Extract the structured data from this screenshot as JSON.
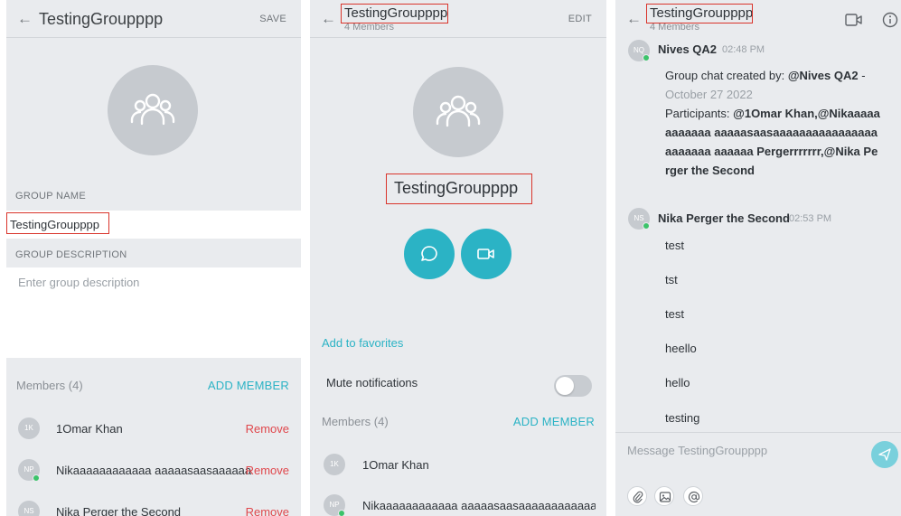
{
  "panel1": {
    "header_title": "TestingGroupppp",
    "header_action": "SAVE",
    "group_name_label": "GROUP NAME",
    "group_name_value": "TestingGroupppp",
    "group_description_label": "GROUP DESCRIPTION",
    "group_description_placeholder": "Enter group description",
    "members_label": "Members (4)",
    "add_member": "ADD MEMBER",
    "members": [
      {
        "initials": "1K",
        "name": "1Omar Khan",
        "action": "Remove"
      },
      {
        "initials": "NP",
        "name": "Nikaaaaaaaaaaaa aaaaasaasaaaaaaa...",
        "action": "Remove"
      },
      {
        "initials": "NS",
        "name": "Nika Perger the Second",
        "action": "Remove"
      }
    ]
  },
  "panel2": {
    "header_title": "TestingGroupppp",
    "header_subtitle": "4 Members",
    "header_action": "EDIT",
    "group_name": "TestingGroupppp",
    "add_to_favorites": "Add to favorites",
    "mute_notifications": "Mute notifications",
    "members_label": "Members (4)",
    "add_member": "ADD MEMBER",
    "members": [
      {
        "initials": "1K",
        "name": "1Omar Khan"
      },
      {
        "initials": "NP",
        "name": "Nikaaaaaaaaaaaa aaaaasaasaaaaaaaaaaaaaaa..."
      }
    ]
  },
  "panel3": {
    "header_title": "TestingGroupppp",
    "header_subtitle": "4 Members",
    "messages": [
      {
        "initials": "NQ",
        "author": "Nives QA2",
        "time": "02:48 PM",
        "text_prefix": "Group chat created by: ",
        "text_creator": "@Nives QA2",
        "text_dash": " -",
        "text_date": "October 27 2022",
        "participants_prefix": "Participants: ",
        "participants": "@1Omar Khan,@Nikaaaaaaaaaaaa aaaaasaasaaaaaaaaaaaaaaaaaaaaaaa aaaaaa Pergerrrrrrr,@Nika Perger the Second"
      },
      {
        "initials": "NS",
        "author": "Nika Perger the Second",
        "time": "02:53 PM",
        "lines": [
          "test",
          "tst",
          "test",
          "heello",
          "hello",
          "testing"
        ]
      }
    ],
    "composer_placeholder": "Message TestingGroupppp"
  },
  "colors": {
    "accent": "#2bb3c5",
    "remove": "#e0474c",
    "panel_bg": "#e9ebee",
    "highlight_box": "#d9342b",
    "online": "#3cc36a"
  }
}
